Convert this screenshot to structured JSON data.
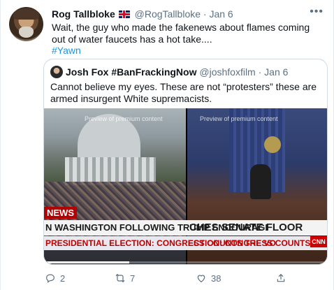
{
  "tweet": {
    "author_name": "Rog Tallbloke",
    "author_handle": "@RogTallbloke",
    "separator": "·",
    "date": "Jan 6",
    "text": "Wait, the guy who made the fakenews about flames coming out of water faucets has a hot take....",
    "hashtag": "#Yawn",
    "more_icon": "more-horizontal-icon",
    "flag_icon": "uk-flag-icon"
  },
  "quoted": {
    "author_name": "Josh Fox #BanFrackingNow",
    "author_handle": "@joshfoxfilm",
    "separator": "·",
    "date": "Jan 6",
    "text": "Cannot believe my eyes. These are not “protesters” these are armed insurgent White supremacists.",
    "media": {
      "preview_left": "Preview of premium content",
      "preview_right": "Preview of premium content",
      "news_label": "NEWS",
      "headline_left": "N WASHINGTON FOLLOWING TRUMP ENCOURAGI",
      "headline_right": "CHES SENATE FLOOR",
      "subticker_left_a": "PRESIDENTIAL ELECTION:",
      "subticker_left_b": " CONGRESS COUNTS THE VO",
      "subticker_right_a": "ECTION:",
      "subticker_right_b": " CONGRESS COUNTS THE VOTE",
      "network_logo": "CNN"
    }
  },
  "actions": {
    "reply_count": "2",
    "retweet_count": "7",
    "like_count": "38",
    "icons": [
      "reply-icon",
      "retweet-icon",
      "like-icon",
      "share-icon"
    ]
  },
  "colors": {
    "link": "#1b95e0",
    "muted": "#5b7083",
    "text": "#0f1419",
    "ticker_red": "#c00000"
  }
}
